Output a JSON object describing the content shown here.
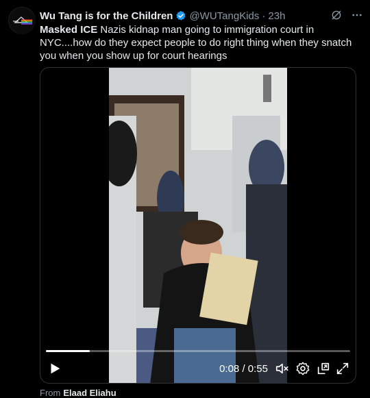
{
  "tweet": {
    "display_name": "Wu Tang is for the Children",
    "handle": "@WUTangKids",
    "separator": "·",
    "timestamp": "23h",
    "text_bold": "Masked ICE",
    "text_body": " Nazis kidnap man going to immigration court in NYC....how do they expect people to do right thing when they snatch you when you show up for court hearings"
  },
  "video": {
    "current_time": "0:08",
    "duration": "0:55",
    "time_sep": " / ",
    "progress_fraction": 0.145
  },
  "icons": {
    "verified": "verified-badge-icon",
    "grok": "grok-icon",
    "more": "more-icon",
    "play": "play-icon",
    "mute": "mute-icon",
    "settings": "settings-icon",
    "popout": "popout-icon",
    "fullscreen": "fullscreen-icon"
  },
  "colors": {
    "accent": "#1d9bf0",
    "background": "#000000",
    "secondary_text": "#8b98a5"
  },
  "from_line": {
    "prefix": "From",
    "name": "Elaad Eliahu"
  }
}
